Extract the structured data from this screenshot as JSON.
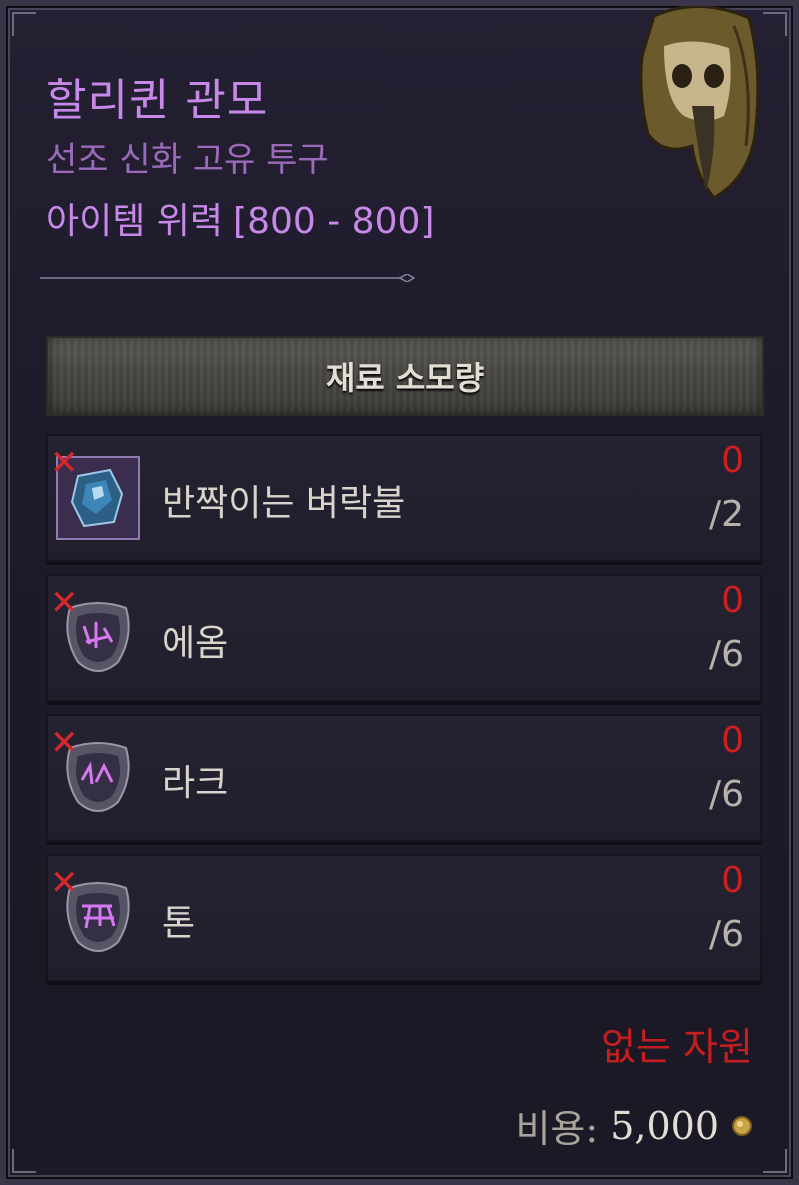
{
  "item": {
    "name": "할리퀸 관모",
    "type": "선조 신화 고유 투구",
    "power_label": "아이템 위력",
    "power_value": "[800 - 800]"
  },
  "materials": {
    "header": "재료 소모량",
    "rows": [
      {
        "name": "반짝이는 벼락불",
        "have": "0",
        "need": "/2",
        "icon": "crystal-icon"
      },
      {
        "name": "에옴",
        "have": "0",
        "need": "/6",
        "icon": "rune-icon"
      },
      {
        "name": "라크",
        "have": "0",
        "need": "/6",
        "icon": "rune-icon"
      },
      {
        "name": "톤",
        "have": "0",
        "need": "/6",
        "icon": "rune-icon"
      }
    ],
    "missing_mark": "✕"
  },
  "footer": {
    "warning": "없는 자원",
    "cost_label": "비용:",
    "cost_value": "5,000"
  },
  "colors": {
    "accent_purple": "#c789e8",
    "missing_red": "#cf1f1f"
  }
}
